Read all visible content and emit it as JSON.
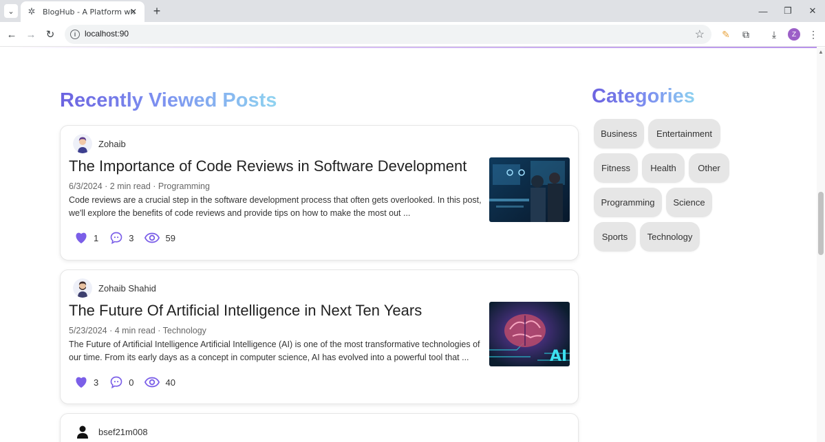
{
  "browser": {
    "tab_title": "BlogHub - A Platform where yo",
    "url": "localhost:90",
    "profile_initial": "Z"
  },
  "page": {
    "section_title": "Recently Viewed Posts",
    "categories_title": "Categories"
  },
  "posts": [
    {
      "author": "Zohaib",
      "title": "The Importance of Code Reviews in Software Development",
      "meta": "6/3/2024 · 2 min read · Programming",
      "excerpt": "Code reviews are a crucial step in the software development process that often gets overlooked. In this post, we'll explore the benefits of code reviews and provide tips on how to make the most out ...",
      "likes": "1",
      "comments": "3",
      "views": "59"
    },
    {
      "author": "Zohaib Shahid",
      "title": "The Future Of Artificial Intelligence in Next Ten Years",
      "meta": "5/23/2024 · 4 min read · Technology",
      "excerpt": "The Future of Artificial Intelligence Artificial Intelligence (AI) is one of the most transformative technologies of our time. From its early days as a concept in computer science, AI has evolved into a powerful tool that ...",
      "likes": "3",
      "comments": "0",
      "views": "40",
      "image_text": "AI"
    },
    {
      "author": "bsef21m008"
    }
  ],
  "categories": [
    "Business",
    "Entertainment",
    "Fitness",
    "Health",
    "Other",
    "Programming",
    "Science",
    "Sports",
    "Technology"
  ],
  "colors": {
    "accent": "#7b5fe8",
    "heading_gradient_start": "#6c63e0",
    "heading_gradient_end": "#8fd3f0",
    "chip_bg": "#e6e6e6"
  }
}
